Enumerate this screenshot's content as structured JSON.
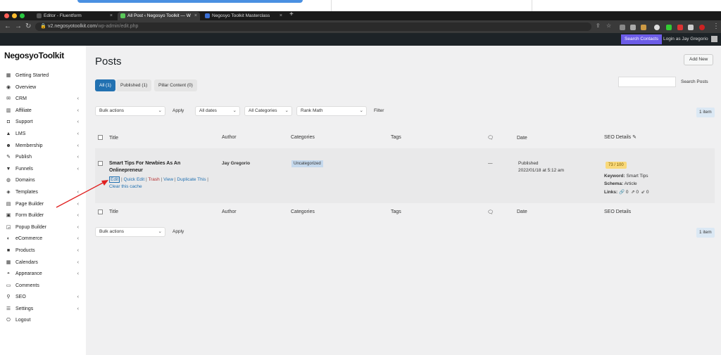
{
  "browser": {
    "tabs": [
      {
        "label": "Editor - Fluentform",
        "active": false
      },
      {
        "label": "All Post ‹ Negosyo Toolkit — W",
        "active": true
      },
      {
        "label": "Negosyo Toolkit Masterclass",
        "active": false
      }
    ],
    "new_tab": "+",
    "url_host": "v2.negosyotoolkit.com",
    "url_path": "/wp-admin/edit.php"
  },
  "adminbar": {
    "search_contacts": "Search Contacts",
    "login_as": "Login as Jay Gregorio"
  },
  "sidebar": {
    "logo": "NegosyoToolkit",
    "items": [
      {
        "label": "Getting Started",
        "icon": "grid-icon",
        "glyph": "▦",
        "chev": false
      },
      {
        "label": "Overview",
        "icon": "eye-icon",
        "glyph": "◉",
        "chev": false
      },
      {
        "label": "CRM",
        "icon": "envelope-icon",
        "glyph": "✉",
        "chev": true
      },
      {
        "label": "Affiliate",
        "icon": "chart-icon",
        "glyph": "▥",
        "chev": true
      },
      {
        "label": "Support",
        "icon": "chat-icon",
        "glyph": "◘",
        "chev": true
      },
      {
        "label": "LMS",
        "icon": "graduation-icon",
        "glyph": "▲",
        "chev": true
      },
      {
        "label": "Membership",
        "icon": "users-icon",
        "glyph": "☻",
        "chev": true
      },
      {
        "label": "Publish",
        "icon": "pencil-icon",
        "glyph": "✎",
        "chev": true
      },
      {
        "label": "Funnels",
        "icon": "funnel-icon",
        "glyph": "▼",
        "chev": true
      },
      {
        "label": "Domains",
        "icon": "globe-icon",
        "glyph": "◍",
        "chev": false
      },
      {
        "label": "Templates",
        "icon": "layers-icon",
        "glyph": "◈",
        "chev": true
      },
      {
        "label": "Page Builder",
        "icon": "page-icon",
        "glyph": "▤",
        "chev": true
      },
      {
        "label": "Form Builder",
        "icon": "form-icon",
        "glyph": "▣",
        "chev": true
      },
      {
        "label": "Popup Builder",
        "icon": "popup-icon",
        "glyph": "◲",
        "chev": true
      },
      {
        "label": "eCommerce",
        "icon": "cart-icon",
        "glyph": "◐",
        "chev": true
      },
      {
        "label": "Products",
        "icon": "box-icon",
        "glyph": "■",
        "chev": true
      },
      {
        "label": "Calendars",
        "icon": "calendar-icon",
        "glyph": "▦",
        "chev": true
      },
      {
        "label": "Appearance",
        "icon": "palette-icon",
        "glyph": "◓",
        "chev": true
      },
      {
        "label": "Comments",
        "icon": "comment-icon",
        "glyph": "▭",
        "chev": false
      },
      {
        "label": "SEO",
        "icon": "search-icon",
        "glyph": "⚲",
        "chev": true
      },
      {
        "label": "Settings",
        "icon": "sliders-icon",
        "glyph": "☰",
        "chev": true
      },
      {
        "label": "Logout",
        "icon": "power-icon",
        "glyph": "⏻",
        "chev": false
      }
    ]
  },
  "page": {
    "title": "Posts",
    "add_new": "Add New",
    "status_tabs": [
      {
        "label": "All (1)",
        "active": true
      },
      {
        "label": "Published (1)",
        "active": false
      },
      {
        "label": "Pillar Content (0)",
        "active": false
      }
    ],
    "search_button": "Search Posts",
    "bulk_actions": "Bulk actions",
    "apply": "Apply",
    "all_dates": "All dates",
    "all_categories": "All Categories",
    "rank_math": "Rank Math",
    "filter": "Filter",
    "item_count": "1 item"
  },
  "table": {
    "headers": {
      "title": "Title",
      "author": "Author",
      "categories": "Categories",
      "tags": "Tags",
      "date": "Date",
      "seo": "SEO Details"
    },
    "row": {
      "title": "Smart Tips For Newbies As An Onlinepreneur",
      "actions": {
        "edit": "Edit",
        "quick_edit": "Quick Edit",
        "trash": "Trash",
        "view": "View",
        "duplicate": "Duplicate This",
        "clear_cache": "Clear this cache"
      },
      "author": "Jay Gregorio",
      "category": "Uncategorized",
      "tags": "—",
      "date_status": "Published",
      "date_value": "2022/01/18 at 5:12 am",
      "seo_score": "73 / 100",
      "keyword_label": "Keyword:",
      "keyword_value": "Smart Tips",
      "schema_label": "Schema:",
      "schema_value": "Article",
      "links_label": "Links:",
      "links_internal": "0",
      "links_external": "0",
      "links_incoming": "0"
    }
  },
  "colors": {
    "accent": "#2271b1",
    "admin_bar": "#1d2327",
    "search_contacts": "#6c5ce7",
    "score_bg": "#f9d97a",
    "annotation_arrow": "#e02020"
  }
}
